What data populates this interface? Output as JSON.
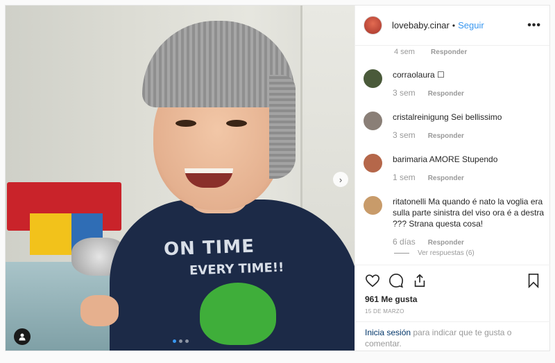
{
  "post": {
    "author": "lovebaby.cinar",
    "separator": "•",
    "follow_label": "Seguir",
    "more_icon": "more-horizontal-icon",
    "more_label": "•••",
    "carousel": {
      "current": 1,
      "total": 3
    }
  },
  "photo": {
    "shirt_line1": "ON TIME",
    "shirt_line2": "EVERY TIME!!"
  },
  "comments": {
    "partial_top": {
      "time": "4 sem",
      "reply": "Responder"
    },
    "items": [
      {
        "user": "corraolaura",
        "text": "☐",
        "time": "3 sem",
        "reply": "Responder",
        "avatar_color": "#4a5a3a"
      },
      {
        "user": "cristalreinigung",
        "text": "Sei bellissimo",
        "time": "3 sem",
        "reply": "Responder",
        "avatar_color": "#8a7f77"
      },
      {
        "user": "barimaria",
        "text": "AMORE Stupendo",
        "time": "1 sem",
        "reply": "Responder",
        "avatar_color": "#b5674a"
      },
      {
        "user": "ritatonelli",
        "text": "Ma quando é nato la voglia era sulla parte sinistra del viso ora é a destra ??? Strana questa cosa!",
        "time": "6 días",
        "reply": "Responder",
        "avatar_color": "#c89b6a"
      }
    ],
    "view_replies": "Ver respuestas (6)"
  },
  "actions": {
    "likes": "961 Me gusta",
    "date": "15 DE MARZO"
  },
  "login": {
    "link": "Inicia sesión",
    "rest": " para indicar que te gusta o comentar."
  },
  "colors": {
    "accent": "#3897f0",
    "muted": "#999999",
    "text": "#262626",
    "link": "#003569"
  }
}
